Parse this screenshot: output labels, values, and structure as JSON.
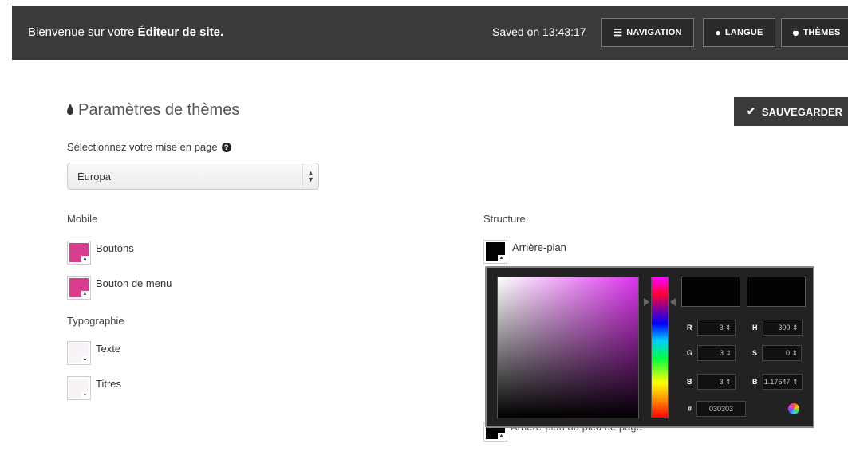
{
  "header": {
    "welcome_prefix": "Bienvenue sur votre",
    "welcome_app": "Éditeur de site.",
    "saved_status": "Saved on 13:43:17",
    "nav_label": "NAVIGATION",
    "lang_label": "LANGUE",
    "themes_label": "THÈMES"
  },
  "page": {
    "title": "Paramètres de thèmes",
    "save_label": "SAUVEGARDER",
    "layout_label": "Sélectionnez votre mise en page",
    "layout_value": "Europa"
  },
  "mobile": {
    "heading": "Mobile",
    "items": [
      {
        "label": "Boutons",
        "color": "#d83c8e"
      },
      {
        "label": "Bouton de menu",
        "color": "#d83c8e"
      }
    ]
  },
  "typography": {
    "heading": "Typographie",
    "items": [
      {
        "label": "Texte",
        "color": "#f7f3f7"
      },
      {
        "label": "Titres",
        "color": "#f7f3f7"
      }
    ]
  },
  "structure": {
    "heading": "Structure",
    "items": [
      {
        "label": "Arrière-plan",
        "color": "#030303"
      },
      {
        "label": "Arrière-plan du pied de page",
        "color": "#030303"
      }
    ]
  },
  "color_picker": {
    "r_label": "R",
    "r_value": "3",
    "g_label": "G",
    "g_value": "3",
    "b_label": "B",
    "b_value": "3",
    "h_label": "H",
    "h_value": "300",
    "s_label": "S",
    "s_value": "0",
    "b2_label": "B",
    "b2_value": "1.17647",
    "hex_label": "#",
    "hex_value": "030303",
    "current_color": "#030303"
  }
}
